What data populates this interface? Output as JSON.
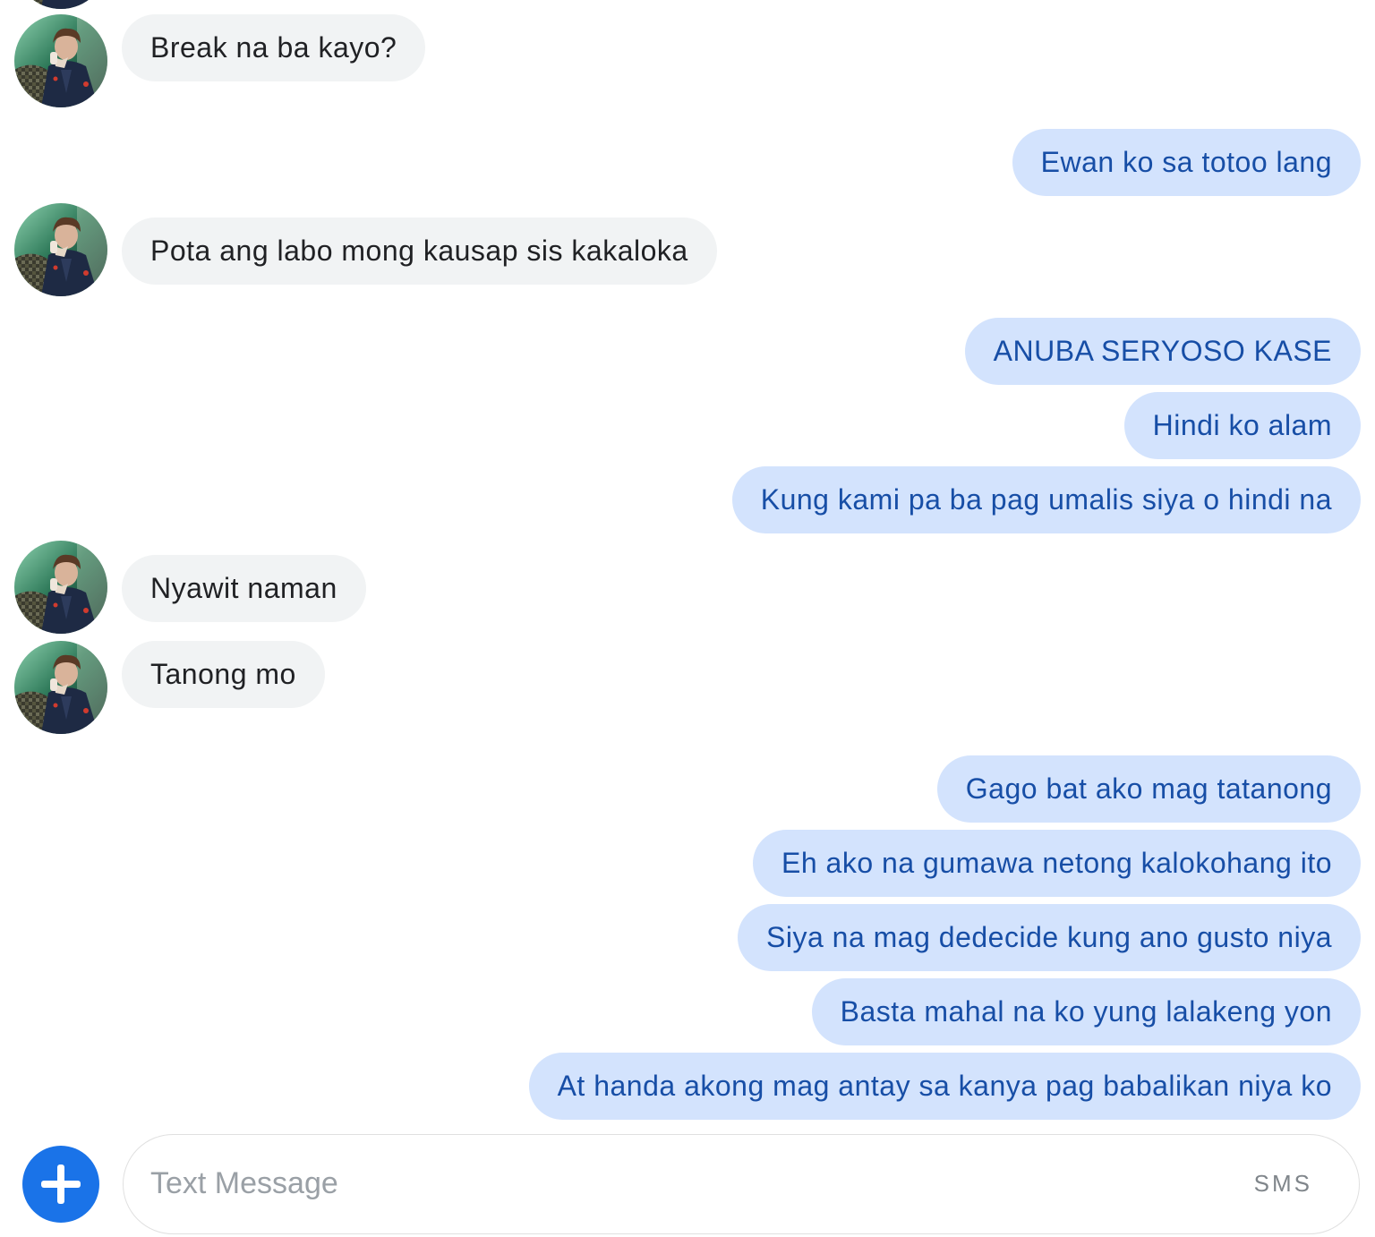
{
  "conversation": {
    "messages": [
      {
        "direction": "incoming",
        "text": "Break na ba kayo?"
      },
      {
        "direction": "outgoing",
        "text": "Ewan ko sa totoo lang"
      },
      {
        "direction": "incoming",
        "text": "Pota ang labo mong kausap sis kakaloka"
      },
      {
        "direction": "outgoing",
        "text": "ANUBA SERYOSO KASE"
      },
      {
        "direction": "outgoing",
        "text": "Hindi ko alam"
      },
      {
        "direction": "outgoing",
        "text": "Kung kami pa ba pag umalis siya o hindi na"
      },
      {
        "direction": "incoming",
        "text": "Nyawit naman"
      },
      {
        "direction": "incoming",
        "text": "Tanong mo"
      },
      {
        "direction": "outgoing",
        "text": "Gago bat ako mag tatanong"
      },
      {
        "direction": "outgoing",
        "text": "Eh ako na gumawa netong kalokohang ito"
      },
      {
        "direction": "outgoing",
        "text": "Siya na mag dedecide kung ano gusto niya"
      },
      {
        "direction": "outgoing",
        "text": "Basta mahal na ko yung lalakeng yon"
      },
      {
        "direction": "outgoing",
        "text": "At handa akong mag antay sa kanya pag babalikan niya ko"
      }
    ]
  },
  "compose": {
    "placeholder": "Text Message",
    "value": "",
    "send_mode_label": "SMS",
    "add_icon": "plus-icon"
  },
  "colors": {
    "incoming_bubble": "#f1f3f4",
    "incoming_text": "#202124",
    "outgoing_bubble": "#d3e3fd",
    "outgoing_text": "#174ea6",
    "accent": "#1a73e8"
  }
}
